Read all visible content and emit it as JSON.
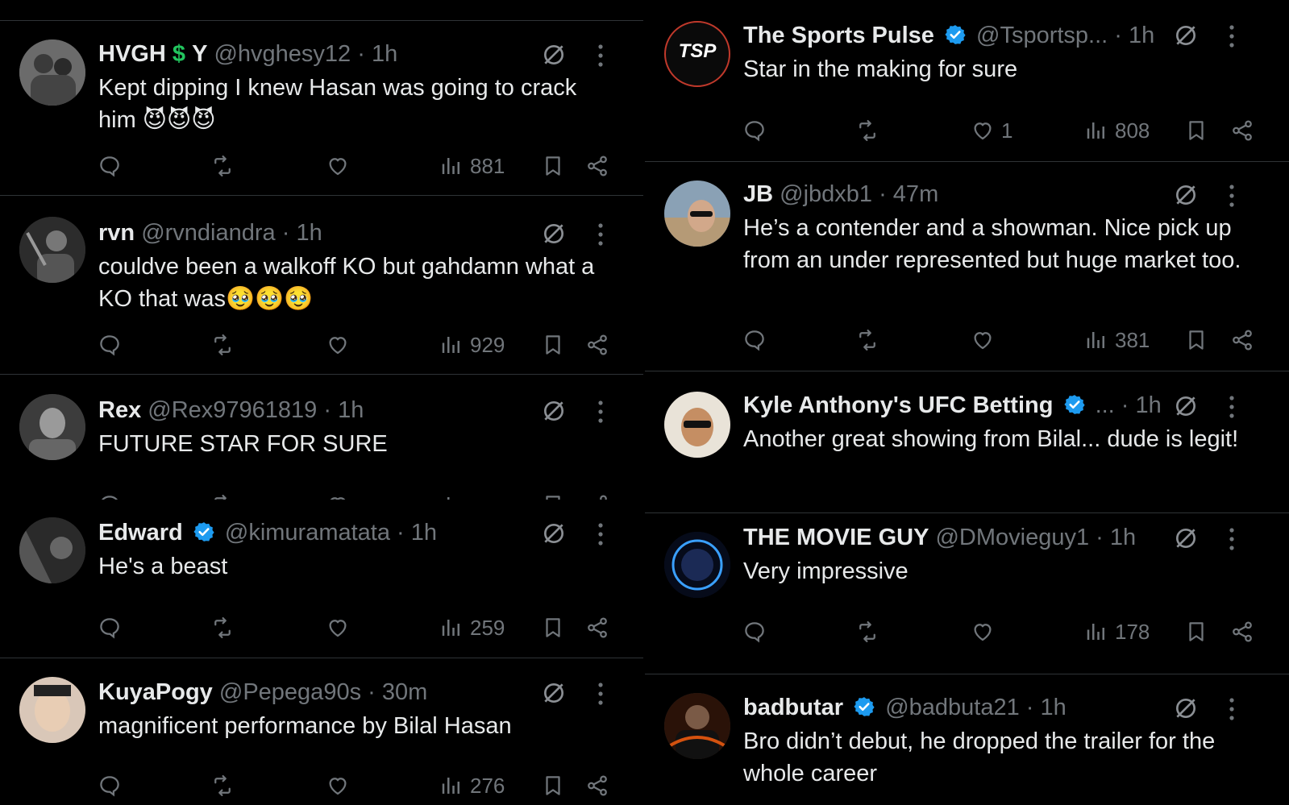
{
  "left": [
    {
      "name": "HVGH",
      "name_suffix": "Y",
      "dollar": "$",
      "handle": "@hvghesy12 · 1h",
      "text": "Kept dipping I knew Hasan was going to crack him 😈😈😈",
      "views": "881"
    },
    {
      "name": "rvn",
      "handle": "@rvndiandra · 1h",
      "text": "couldve been a walkoff KO but gahdamn what a KO that was🥹🥹🥹",
      "views": "929"
    },
    {
      "name": "Rex",
      "handle": "@Rex97961819 · 1h",
      "text": "FUTURE STAR FOR SURE"
    },
    {
      "name": "Edward",
      "handle": "@kimuramatata · 1h",
      "text": "He's a beast",
      "views": "259"
    },
    {
      "name": "KuyaPogy",
      "handle": "@Pepega90s · 30m",
      "text": "magnificent performance by Bilal Hasan",
      "views": "276"
    }
  ],
  "right": [
    {
      "name": "The Sports Pulse",
      "handle": "@Tsportsp... · 1h",
      "text": "Star in the making for sure",
      "likes": "1",
      "views": "808",
      "avatar_label": "TSP"
    },
    {
      "name": "JB",
      "handle": "@jbdxb1 · 47m",
      "text": "He’s a contender and a showman. Nice pick up from an under represented but huge market too.",
      "views": "381"
    },
    {
      "name": "Kyle Anthony's UFC Betting",
      "handle": "... · 1h",
      "text": "Another great showing from Bilal... dude is legit!"
    },
    {
      "name": "THE MOVIE GUY",
      "handle": "@DMovieguy1 · 1h",
      "text": "Very impressive",
      "views": "178"
    },
    {
      "name": "badbutar",
      "handle": "@badbuta21 · 1h",
      "text": "Bro didn’t debut, he dropped the trailer for the whole career"
    }
  ],
  "colors": {
    "verified": "#1d9bf0",
    "muted": "#71767b",
    "text": "#e7e9ea",
    "divider": "#2f3336",
    "dollar": "#22c55e"
  },
  "icons": [
    "reply-icon",
    "retweet-icon",
    "like-icon",
    "views-icon",
    "bookmark-icon",
    "share-icon",
    "grok-icon",
    "more-icon",
    "verified-badge-icon"
  ]
}
